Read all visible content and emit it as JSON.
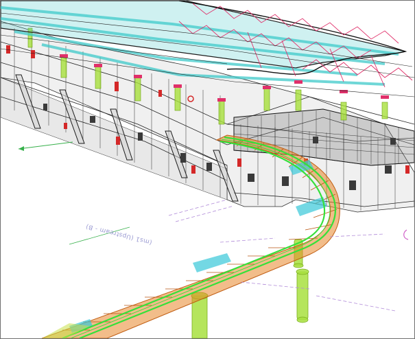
{
  "viewport": {
    "view_mode": "3D view",
    "background": "#ffffff",
    "colors": {
      "roof_glass": "#3fc9c9",
      "truss": "#e0306a",
      "wire": "#1e1e1e",
      "column": "#a8e03c",
      "glazing": "#d8d8d8",
      "guideway": "#e8872a",
      "rail": "#36e03a",
      "guideway_glass": "#38c8d8",
      "pier": "#a8e040",
      "fire_equipment": "#d42828",
      "annotation": "#9a9ad2"
    }
  },
  "annotation": {
    "label": "(ms1 (Upstream - B)"
  }
}
